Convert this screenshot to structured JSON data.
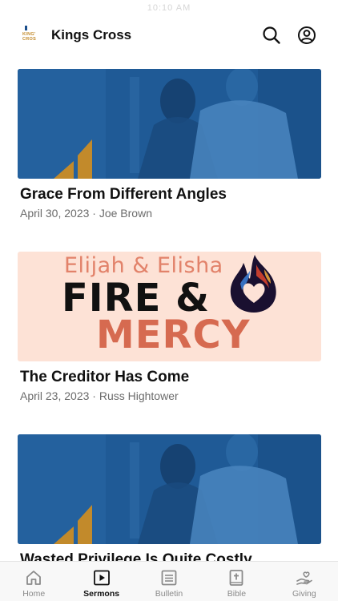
{
  "status_bar": {
    "time": "10:10 AM"
  },
  "header": {
    "logo_text": "KING'\nCROS",
    "title": "Kings Cross",
    "search_icon": "search-icon",
    "profile_icon": "profile-icon"
  },
  "sermons": [
    {
      "title": "Grace From Different Angles",
      "meta": "April 30, 2023 · Joe Brown",
      "image": "photo-blue"
    },
    {
      "title": "The Creditor Has Come",
      "meta": "April 23, 2023 · Russ Hightower",
      "image": "fire-mercy",
      "art": {
        "line1": "Elijah & Elisha",
        "line2": "FIRE &",
        "line3": "MERCY"
      }
    },
    {
      "title": "Wasted Privilege Is Quite Costly",
      "meta": "",
      "image": "photo-blue"
    }
  ],
  "tabs": [
    {
      "label": "Home",
      "icon": "home-icon",
      "active": false
    },
    {
      "label": "Sermons",
      "icon": "play-icon",
      "active": true
    },
    {
      "label": "Bulletin",
      "icon": "bulletin-icon",
      "active": false
    },
    {
      "label": "Bible",
      "icon": "bible-icon",
      "active": false
    },
    {
      "label": "Giving",
      "icon": "giving-icon",
      "active": false
    }
  ],
  "colors": {
    "photo_blue": "#1f5a96",
    "accent_gold": "#c28a2b",
    "fire_bg": "#fde2d6",
    "mercy": "#d66a50",
    "inactive_tab": "#8a8a8a"
  }
}
